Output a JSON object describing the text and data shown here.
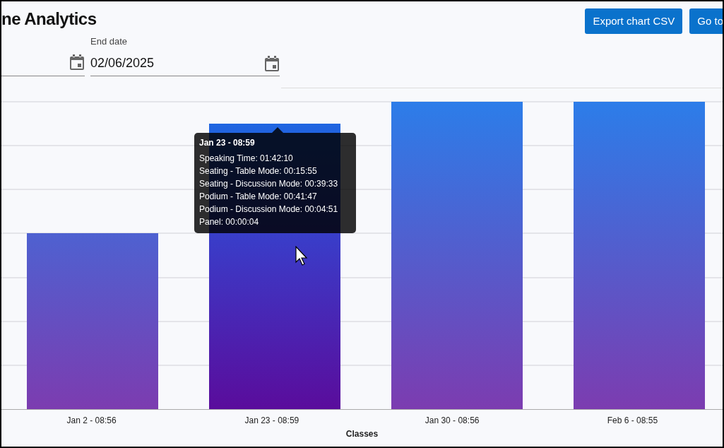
{
  "header": {
    "title": "ne Analytics",
    "buttons": [
      "Export chart CSV",
      "Go to"
    ]
  },
  "end_date": {
    "label": "End date",
    "value": "02/06/2025"
  },
  "chart": {
    "xlabel": "Classes",
    "bars": [
      {
        "label": "Jan 2 - 08:56",
        "selected": false
      },
      {
        "label": "Jan 23 - 08:59",
        "selected": true
      },
      {
        "label": "Jan 30 - 08:56",
        "selected": false
      },
      {
        "label": "Feb 6 - 08:55",
        "selected": false
      }
    ],
    "tooltip": {
      "title": "Jan 23 - 08:59",
      "lines": [
        "Speaking Time: 01:42:10",
        "Seating - Table Mode: 00:15:55",
        "Seating - Discussion Mode: 00:39:33",
        "Podium - Table Mode: 00:41:47",
        "Podium - Discussion Mode: 00:04:51",
        "Panel: 00:00:04"
      ]
    }
  }
}
